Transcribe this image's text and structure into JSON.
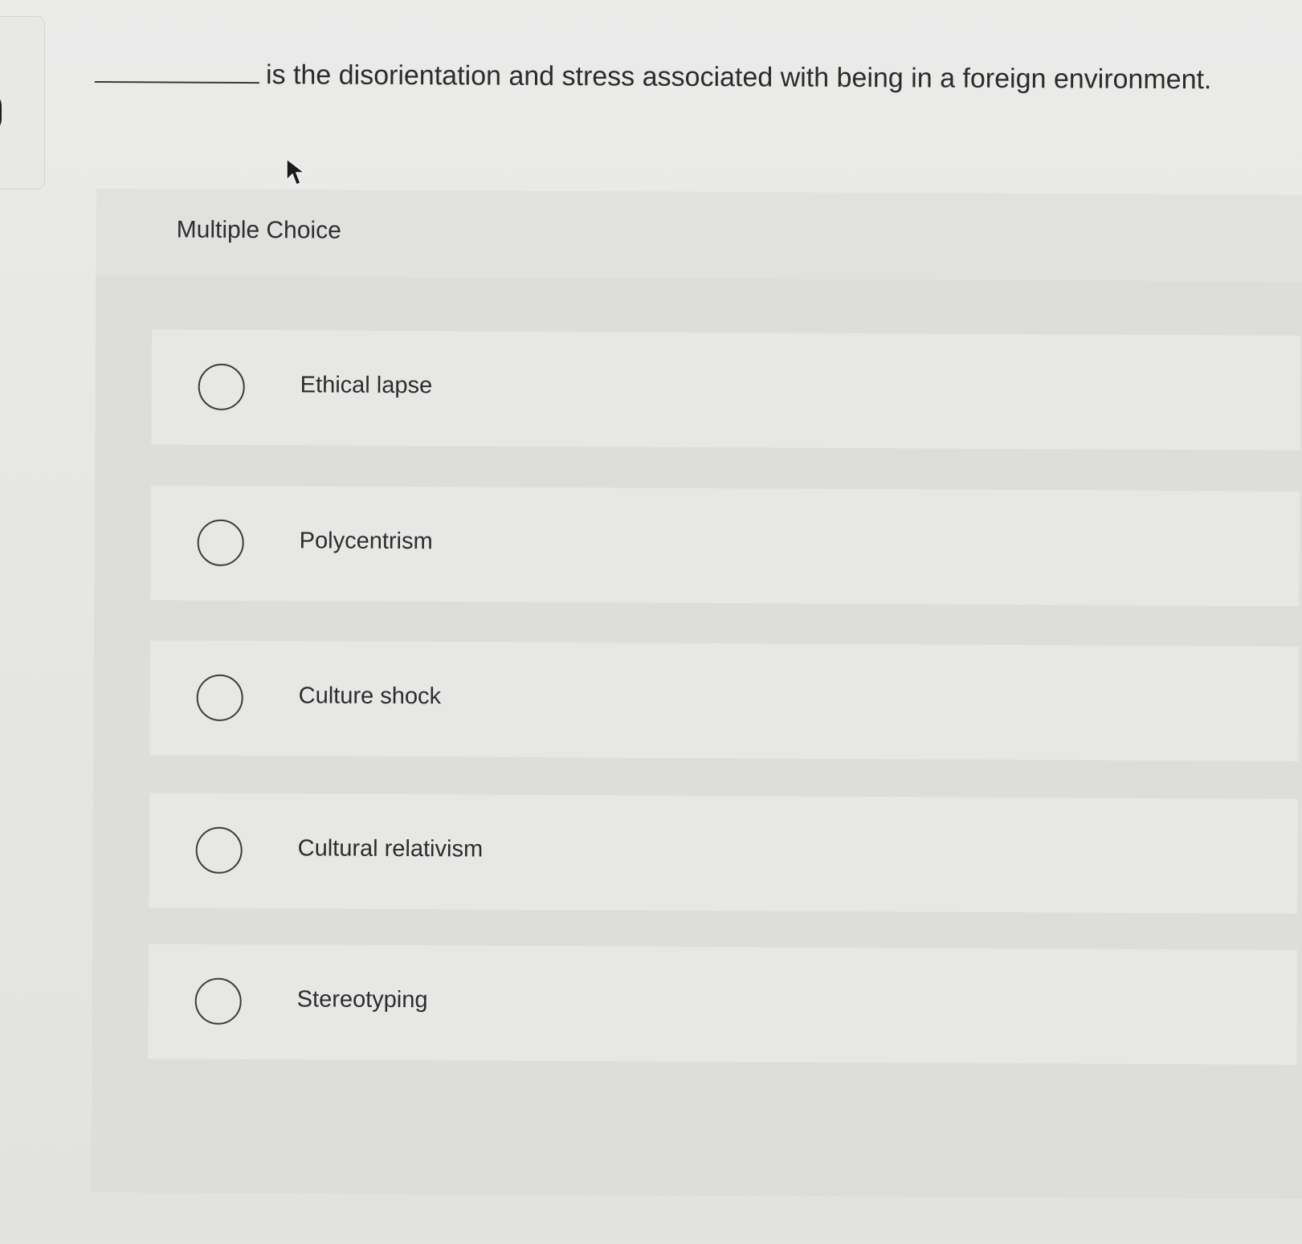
{
  "question": {
    "text": "is the disorientation and stress associated with being in a foreign environment."
  },
  "choice_block": {
    "title": "Multiple Choice",
    "options": [
      {
        "label": "Ethical lapse"
      },
      {
        "label": "Polycentrism"
      },
      {
        "label": "Culture shock"
      },
      {
        "label": "Cultural relativism"
      },
      {
        "label": "Stereotyping"
      }
    ]
  },
  "cursor": {
    "icon": "arrow-cursor-icon"
  }
}
